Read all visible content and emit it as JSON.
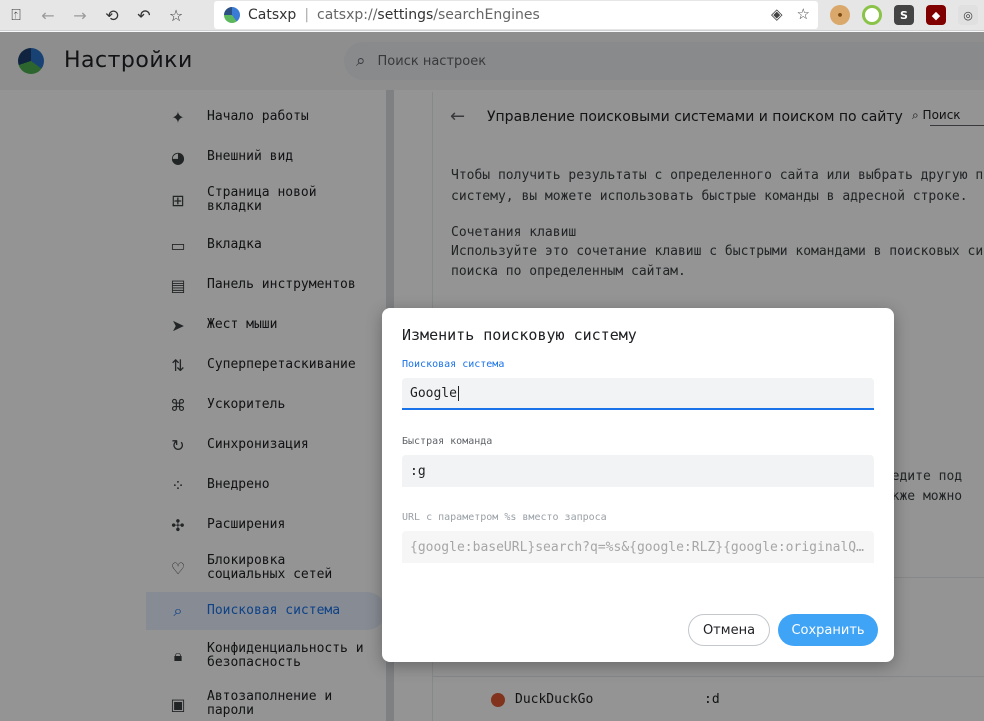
{
  "browser": {
    "site_name": "Catsxp",
    "url_scheme": "catsxp://",
    "url_host": "settings",
    "url_path": "/searchEngines"
  },
  "header": {
    "title": "Настройки",
    "search_placeholder": "Поиск настроек"
  },
  "sidebar": {
    "items": [
      {
        "label": "Начало работы",
        "icon": "sparkle-icon"
      },
      {
        "label": "Внешний вид",
        "icon": "palette-icon"
      },
      {
        "label": "Страница новой вкладки",
        "icon": "new-tab-icon"
      },
      {
        "label": "Вкладка",
        "icon": "folder-tab-icon"
      },
      {
        "label": "Панель инструментов",
        "icon": "toolbar-icon"
      },
      {
        "label": "Жест мыши",
        "icon": "cursor-icon"
      },
      {
        "label": "Суперперетаскивание",
        "icon": "drag-icon"
      },
      {
        "label": "Ускоритель",
        "icon": "command-icon"
      },
      {
        "label": "Синхронизация",
        "icon": "sync-icon"
      },
      {
        "label": "Внедрено",
        "icon": "apps-icon"
      },
      {
        "label": "Расширения",
        "icon": "puzzle-icon"
      },
      {
        "label": "Блокировка социальных сетей",
        "icon": "heart-broken-icon"
      },
      {
        "label": "Поисковая система",
        "icon": "search-icon"
      },
      {
        "label": "Конфиденциальность и безопасность",
        "icon": "lock-icon"
      },
      {
        "label": "Автозаполнение и пароли",
        "icon": "clipboard-icon"
      }
    ]
  },
  "content": {
    "title": "Управление поисковыми системами и поиском по сайту",
    "search_label": "Поиск",
    "para1_line1": "Чтобы получить результаты с определенного сайта или выбрать другую по",
    "para1_line2": "систему, вы можете использовать быстрые команды в адресной строке.",
    "shortcuts_heading": "Сочетания клавиш",
    "para2_line1": "Используйте это сочетание клавиш с быстрыми командами в поисковых сис",
    "para2_line2": "поиска по определенным сайтам.",
    "partial_right_1": "введите под",
    "partial_right_2": "также можно",
    "ddg_name": "DuckDuckGo",
    "ddg_key": ":d"
  },
  "dialog": {
    "title": "Изменить поисковую систему",
    "engine_label": "Поисковая система",
    "engine_value": "Google",
    "shortcut_label": "Быстрая команда",
    "shortcut_value": ":g",
    "url_label": "URL с параметром %s вместо запроса",
    "url_value": "{google:baseURL}search?q=%s&{google:RLZ}{google:originalQ…",
    "cancel_label": "Отмена",
    "save_label": "Сохранить"
  },
  "colors": {
    "accent": "#1a73e8",
    "save_button": "#3fa3f6"
  }
}
